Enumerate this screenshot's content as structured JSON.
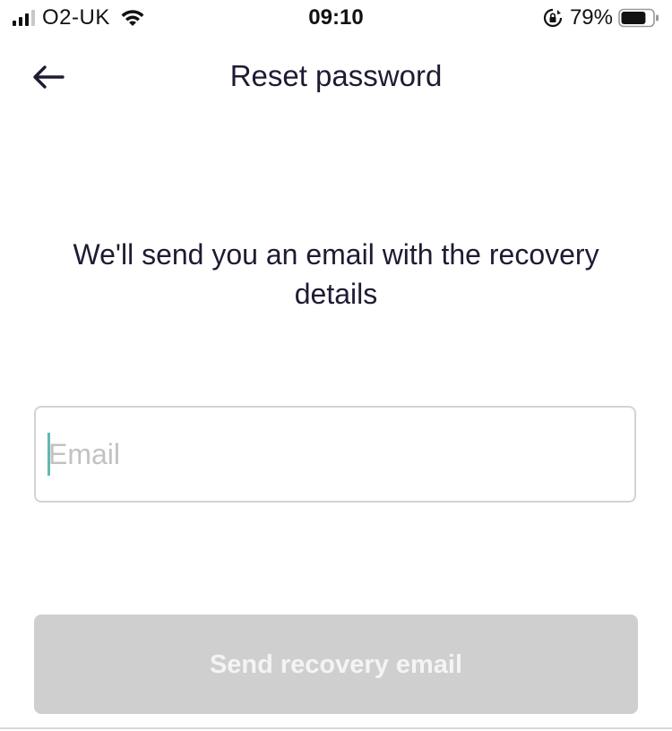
{
  "status_bar": {
    "carrier": "O2-UK",
    "time": "09:10",
    "battery_percent": "79%",
    "icons": [
      "signal-icon",
      "wifi-icon",
      "rotation-lock-icon",
      "battery-icon"
    ],
    "battery_level": 0.79
  },
  "header": {
    "title": "Reset password",
    "back_icon": "back-arrow-icon"
  },
  "main": {
    "instructions": "We'll send you an email with the recovery details",
    "email": {
      "placeholder": "Email",
      "value": ""
    },
    "submit_label": "Send recovery email"
  },
  "colors": {
    "text": "#1e1b33",
    "caret": "#63b8b0",
    "button_disabled": "#cfcfcf",
    "input_border": "#d3d3d3"
  }
}
